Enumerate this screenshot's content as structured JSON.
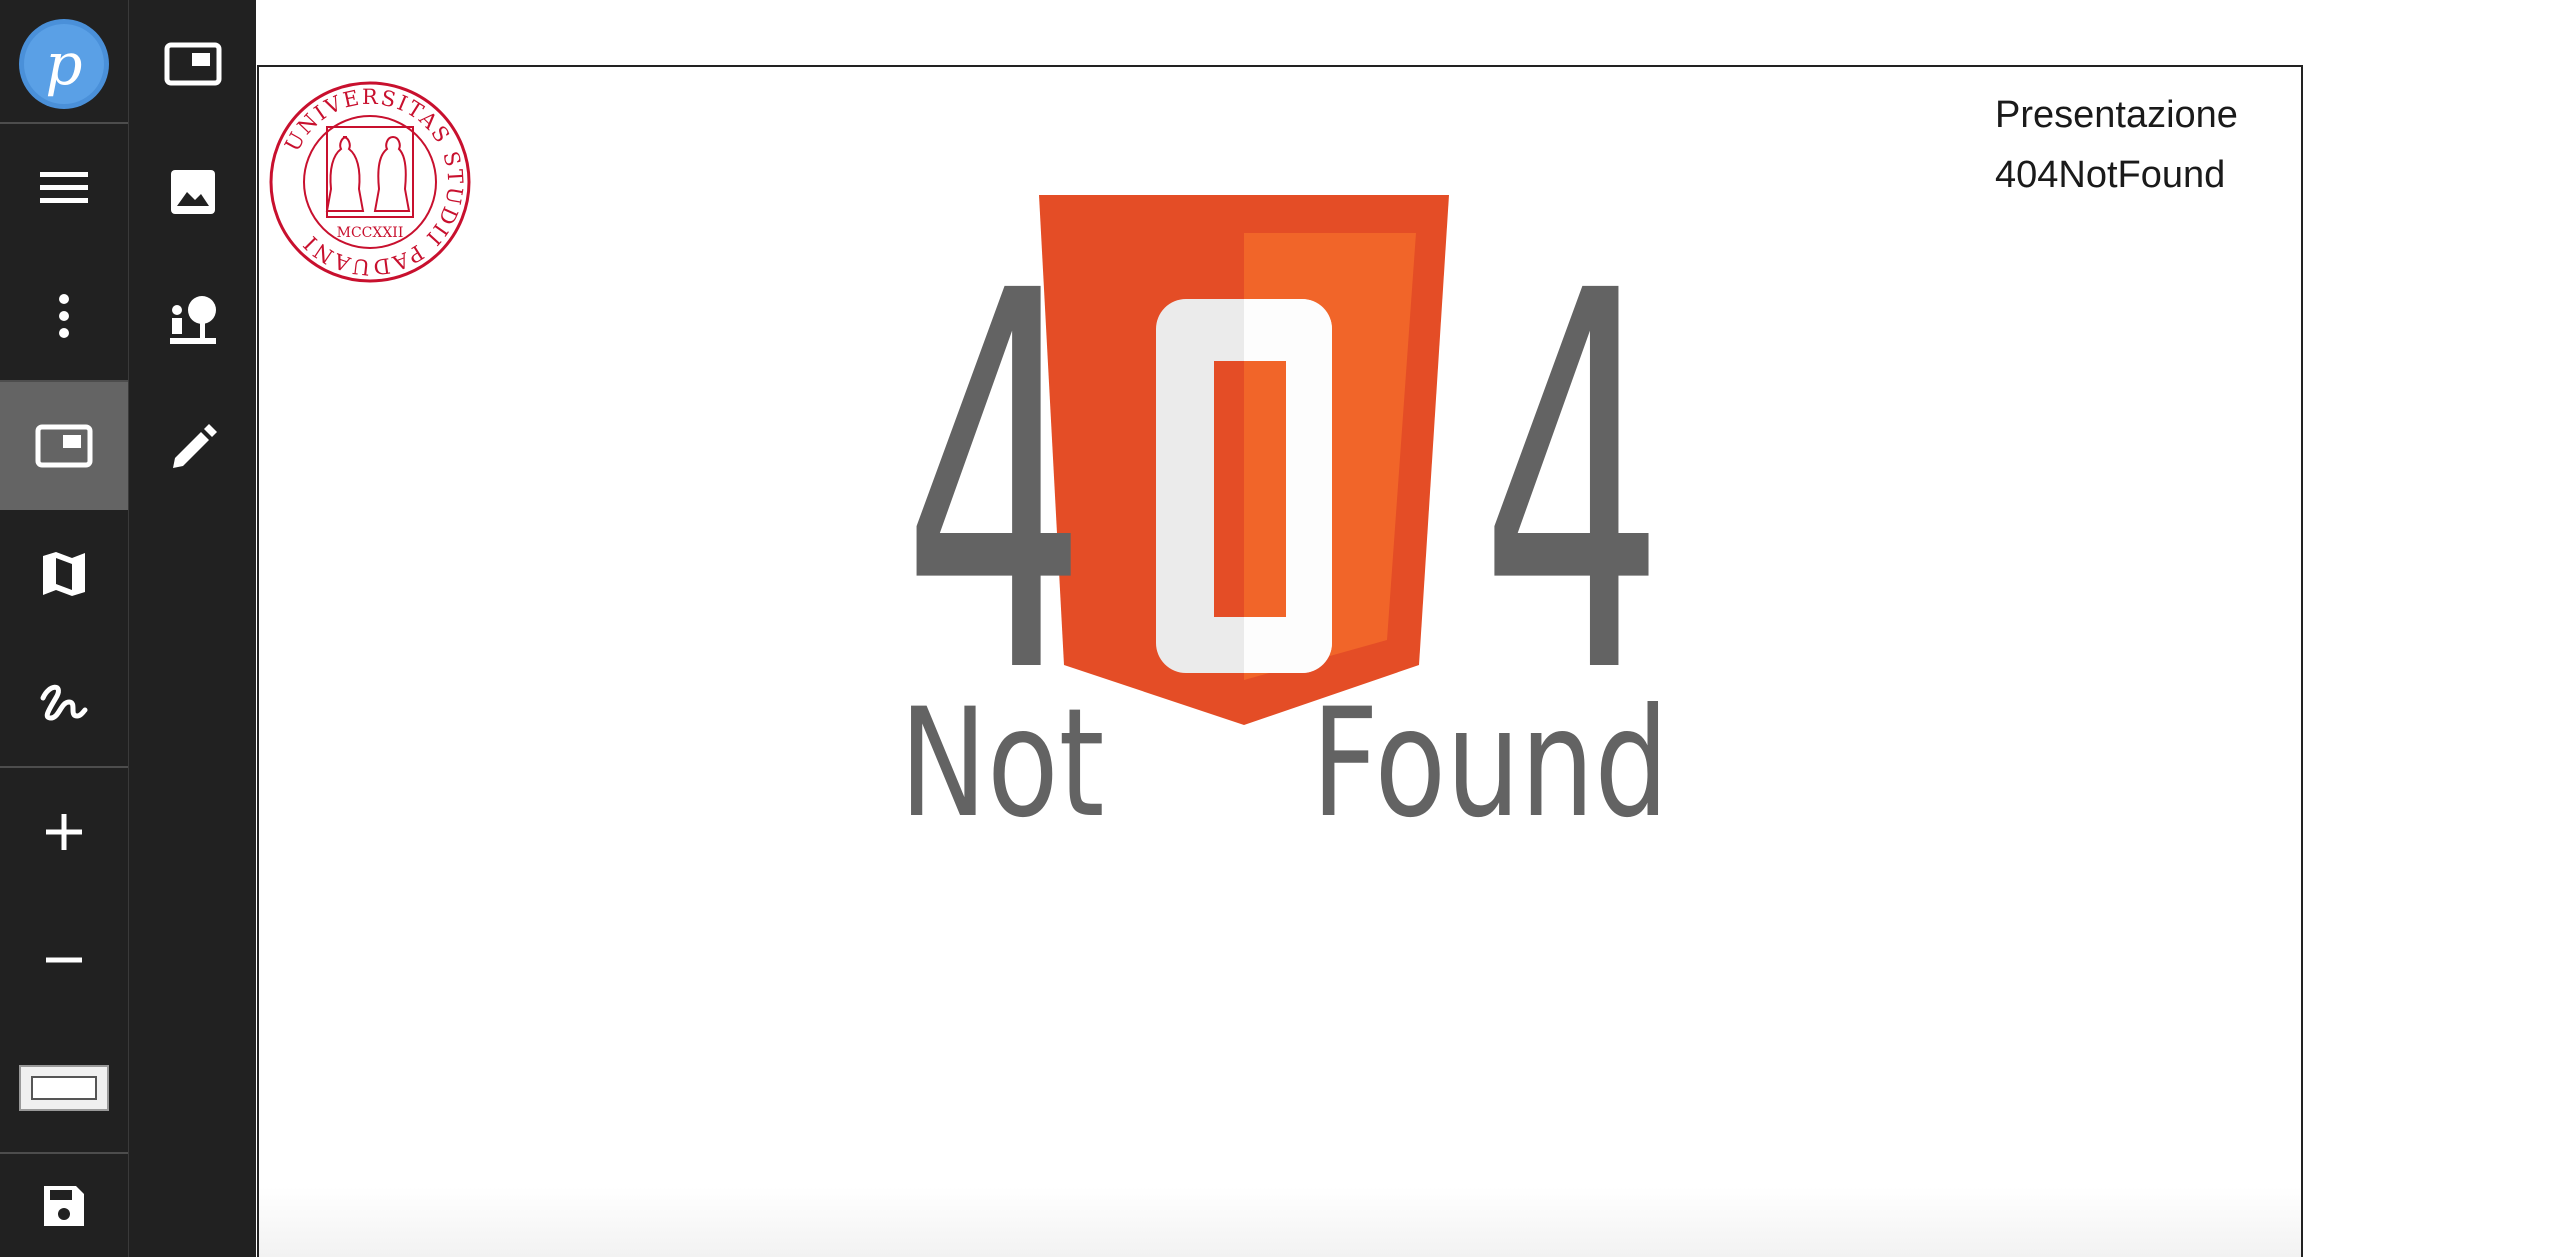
{
  "app": {
    "logo_letter": "p"
  },
  "rail": {
    "items": [
      {
        "icon": "app-logo"
      },
      {
        "icon": "menu-icon"
      },
      {
        "icon": "more-vertical-icon"
      },
      {
        "icon": "frame-icon",
        "active": true
      },
      {
        "icon": "map-icon"
      },
      {
        "icon": "draw-icon"
      },
      {
        "icon": "plus-icon"
      },
      {
        "icon": "minus-icon"
      },
      {
        "icon": "rectangle-icon"
      },
      {
        "icon": "save-icon"
      }
    ]
  },
  "palette": {
    "items": [
      {
        "icon": "frame-icon"
      },
      {
        "icon": "image-icon"
      },
      {
        "icon": "person-tree-icon"
      },
      {
        "icon": "pencil-icon"
      }
    ]
  },
  "canvas": {
    "title_line1": "Presentazione",
    "title_line2": "404NotFound",
    "seal_text": "UNIVERSITAS STUDII PADUANI",
    "seal_year": "MCCXXII",
    "logo_left_digit": "4",
    "logo_right_digit": "4",
    "logo_word_left": "Not",
    "logo_word_right": "Found",
    "colors": {
      "shield_dark": "#e44d26",
      "shield_light": "#f16529",
      "digit_gray": "#636363",
      "seal_red": "#c8102e"
    }
  }
}
